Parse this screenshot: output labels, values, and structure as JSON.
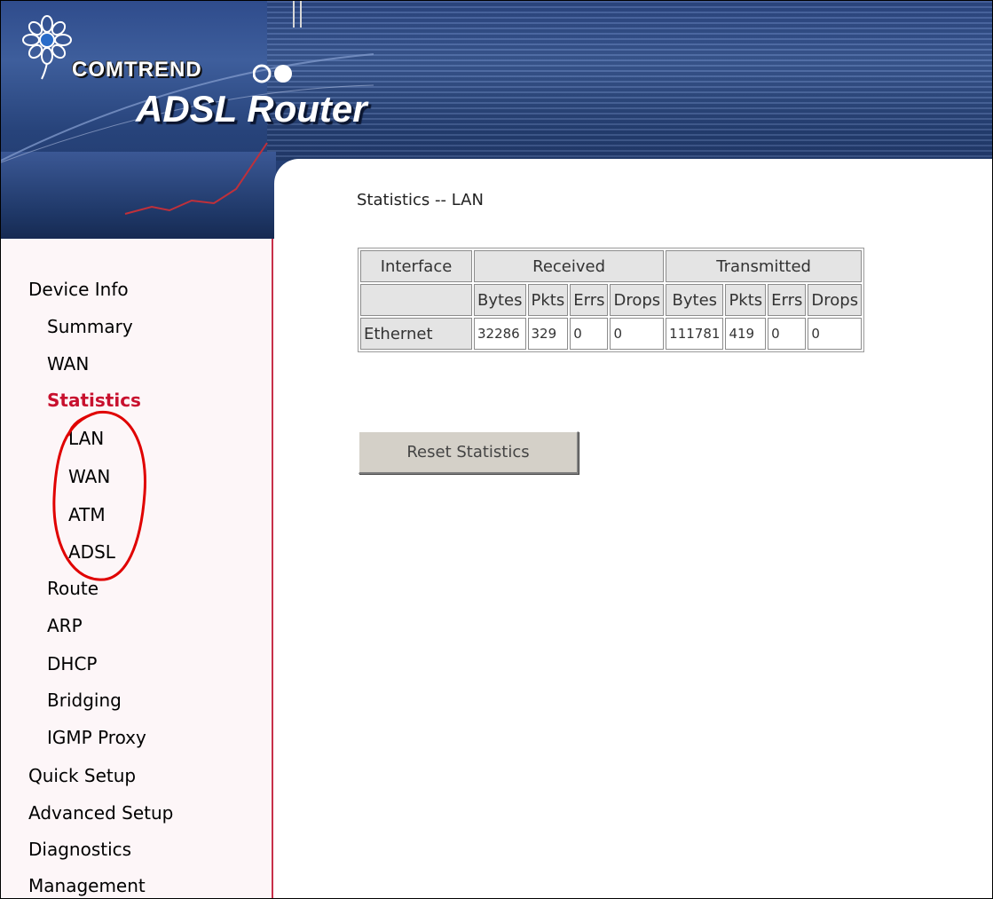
{
  "header": {
    "brand": "COMTREND",
    "product": "ADSL Router"
  },
  "sidebar": {
    "items": [
      {
        "label": "Device Info"
      },
      {
        "label": "Summary"
      },
      {
        "label": "WAN"
      },
      {
        "label": "Statistics"
      },
      {
        "label": "LAN"
      },
      {
        "label": "WAN"
      },
      {
        "label": "ATM"
      },
      {
        "label": "ADSL"
      },
      {
        "label": "Route"
      },
      {
        "label": "ARP"
      },
      {
        "label": "DHCP"
      },
      {
        "label": "Bridging"
      },
      {
        "label": "IGMP Proxy"
      },
      {
        "label": "Quick Setup"
      },
      {
        "label": "Advanced Setup"
      },
      {
        "label": "Diagnostics"
      },
      {
        "label": "Management"
      }
    ],
    "active_color": "#c8102e"
  },
  "main": {
    "heading": "Statistics -- LAN",
    "table": {
      "interface_header": "Interface",
      "received_header": "Received",
      "transmitted_header": "Transmitted",
      "sub_headers": [
        "Bytes",
        "Pkts",
        "Errs",
        "Drops",
        "Bytes",
        "Pkts",
        "Errs",
        "Drops"
      ],
      "rows": [
        {
          "interface": "Ethernet",
          "values": [
            "32286",
            "329",
            "0",
            "0",
            "111781",
            "419",
            "0",
            "0"
          ]
        }
      ]
    },
    "reset_button": "Reset Statistics"
  },
  "annotation": {
    "color": "#e00000"
  }
}
